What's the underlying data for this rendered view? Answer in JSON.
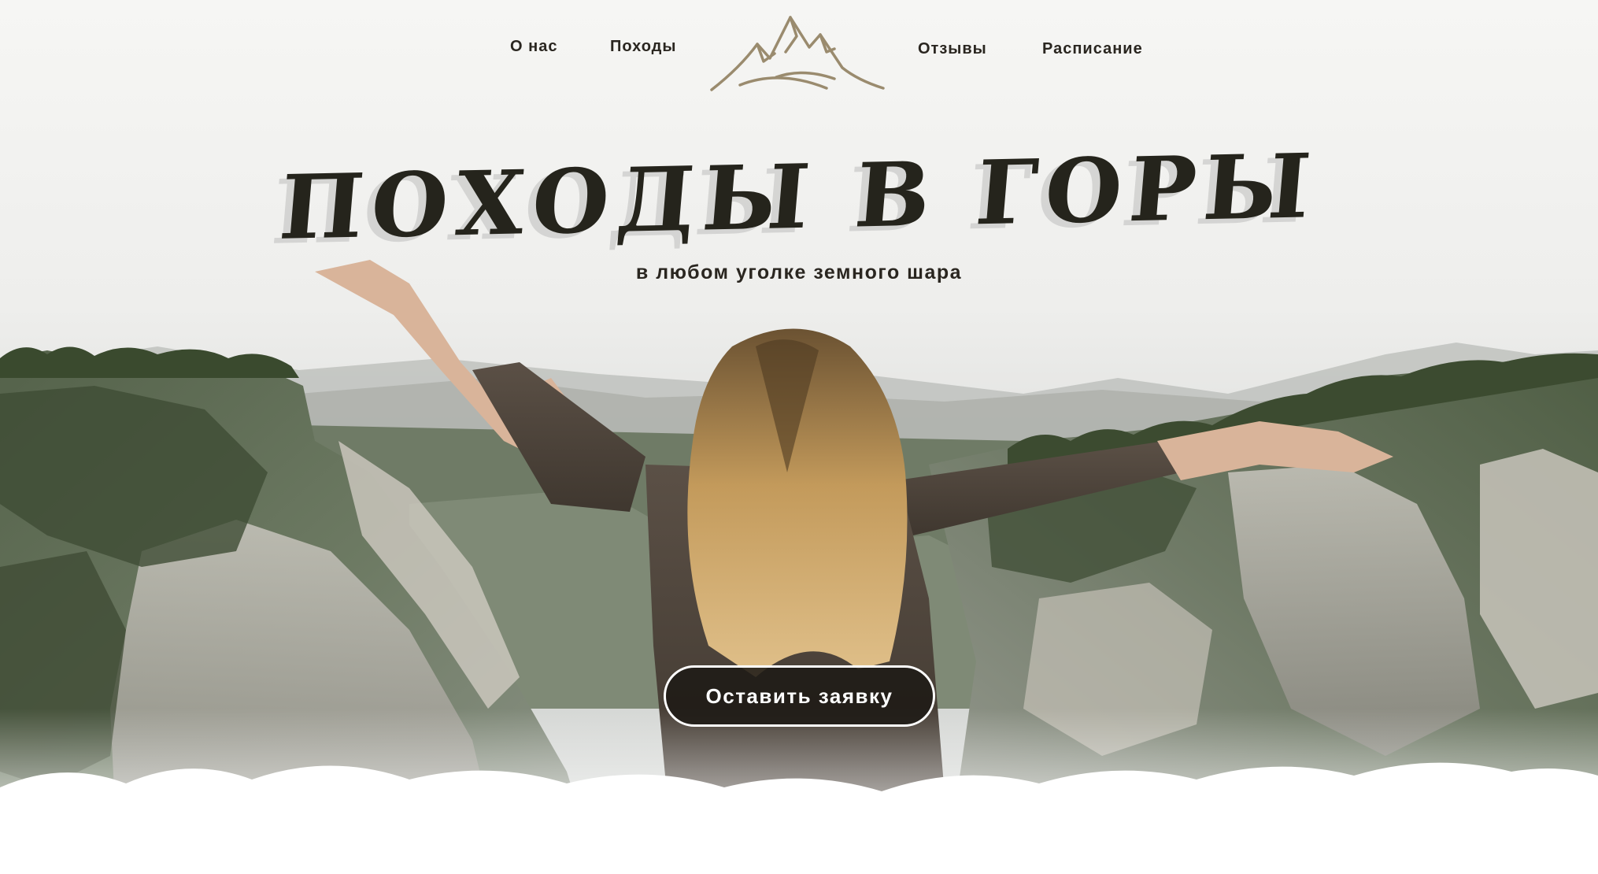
{
  "nav": {
    "items": [
      {
        "label": "О нас"
      },
      {
        "label": "Походы"
      },
      {
        "label": "Отзывы"
      },
      {
        "label": "Расписание"
      }
    ]
  },
  "hero": {
    "title": "ПОХОДЫ В ГОРЫ",
    "subtitle": "в любом уголке земного шара",
    "cta_label": "Оставить заявку"
  },
  "colors": {
    "text_dark": "#2a2620",
    "title": "#25241c",
    "logo_gold": "#9a8b6e",
    "button_bg": "#1e1a16",
    "button_border": "#ffffff"
  }
}
